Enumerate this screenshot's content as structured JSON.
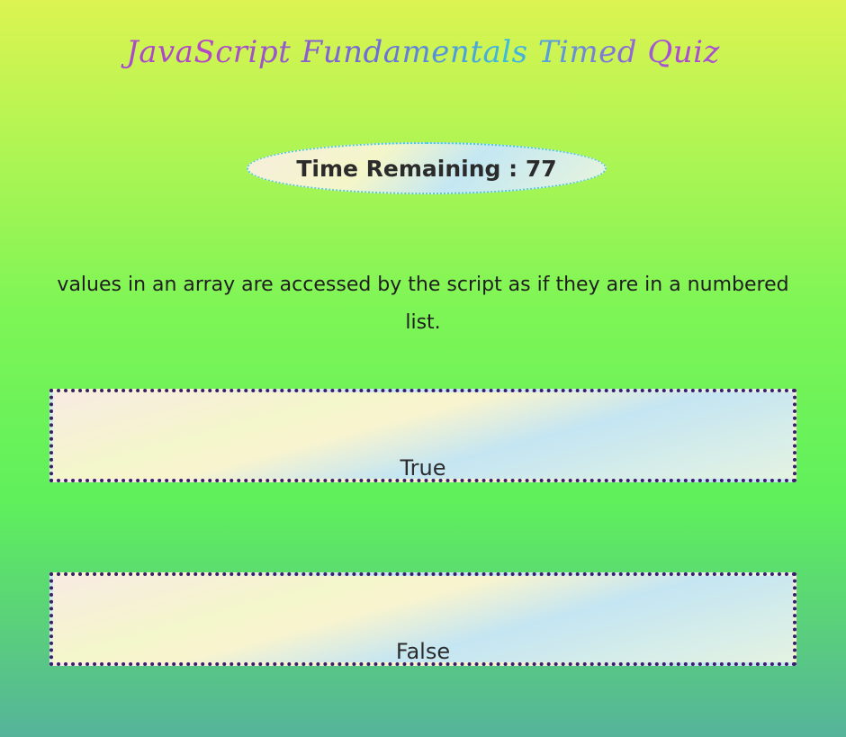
{
  "header": {
    "title": "JavaScript Fundamentals Timed Quiz"
  },
  "timer": {
    "label": "Time Remaining : ",
    "value": "77"
  },
  "question": {
    "text": "values in an array are accessed by the script as if they are in a numbered list."
  },
  "answers": [
    {
      "label": "True"
    },
    {
      "label": "False"
    }
  ],
  "colors": {
    "background_top": "#dcf451",
    "background_middle": "#5ff05c",
    "background_bottom": "#55b39a",
    "answer_border": "#3c1c6e",
    "timer_border": "#4ec9d6"
  }
}
